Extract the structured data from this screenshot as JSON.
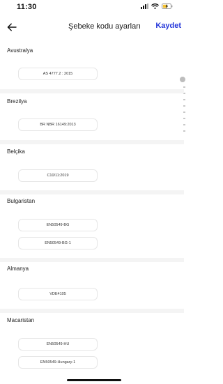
{
  "status_bar": {
    "time": "11:30"
  },
  "header": {
    "title": "Şebeke kodu ayarları",
    "save_label": "Kaydet",
    "back_icon": "arrow-left-icon"
  },
  "sections": [
    {
      "country": "Avustralya",
      "codes": [
        "AS 4777.2 : 2015"
      ]
    },
    {
      "country": "Brezilya",
      "codes": [
        "BR NBR 16149:2013"
      ]
    },
    {
      "country": "Belçika",
      "codes": [
        "C10/11:2019"
      ]
    },
    {
      "country": "Bulgaristan",
      "codes": [
        "EN50549-BG",
        "EN50549-BG-1"
      ]
    },
    {
      "country": "Almanya",
      "codes": [
        "VDE4105"
      ]
    },
    {
      "country": "Macaristan",
      "codes": [
        "EN50549-HU",
        "EN50549-Hungary-1"
      ]
    }
  ],
  "colors": {
    "accent": "#2436d9",
    "divider": "#f4f4f4",
    "pill_border": "#e6e6e6"
  }
}
